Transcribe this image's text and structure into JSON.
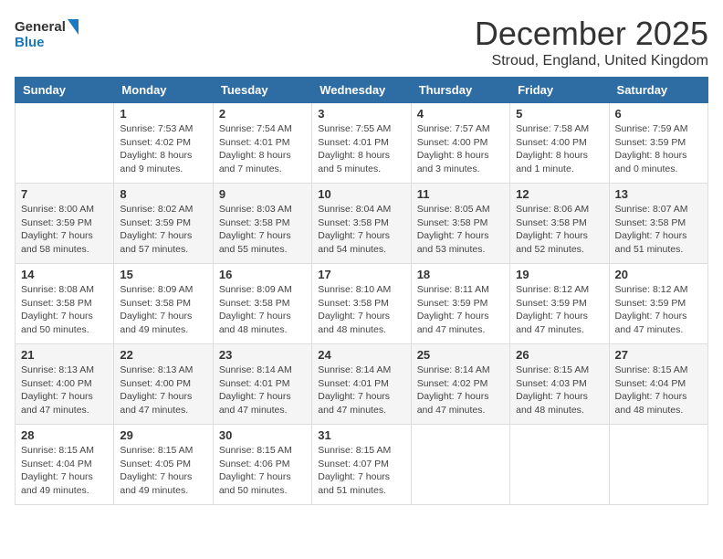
{
  "logo": {
    "line1": "General",
    "line2": "Blue"
  },
  "title": "December 2025",
  "location": "Stroud, England, United Kingdom",
  "weekdays": [
    "Sunday",
    "Monday",
    "Tuesday",
    "Wednesday",
    "Thursday",
    "Friday",
    "Saturday"
  ],
  "weeks": [
    [
      {
        "num": "",
        "sunrise": "",
        "sunset": "",
        "daylight": ""
      },
      {
        "num": "1",
        "sunrise": "7:53 AM",
        "sunset": "4:02 PM",
        "daylight": "8 hours and 9 minutes."
      },
      {
        "num": "2",
        "sunrise": "7:54 AM",
        "sunset": "4:01 PM",
        "daylight": "8 hours and 7 minutes."
      },
      {
        "num": "3",
        "sunrise": "7:55 AM",
        "sunset": "4:01 PM",
        "daylight": "8 hours and 5 minutes."
      },
      {
        "num": "4",
        "sunrise": "7:57 AM",
        "sunset": "4:00 PM",
        "daylight": "8 hours and 3 minutes."
      },
      {
        "num": "5",
        "sunrise": "7:58 AM",
        "sunset": "4:00 PM",
        "daylight": "8 hours and 1 minute."
      },
      {
        "num": "6",
        "sunrise": "7:59 AM",
        "sunset": "3:59 PM",
        "daylight": "8 hours and 0 minutes."
      }
    ],
    [
      {
        "num": "7",
        "sunrise": "8:00 AM",
        "sunset": "3:59 PM",
        "daylight": "7 hours and 58 minutes."
      },
      {
        "num": "8",
        "sunrise": "8:02 AM",
        "sunset": "3:59 PM",
        "daylight": "7 hours and 57 minutes."
      },
      {
        "num": "9",
        "sunrise": "8:03 AM",
        "sunset": "3:58 PM",
        "daylight": "7 hours and 55 minutes."
      },
      {
        "num": "10",
        "sunrise": "8:04 AM",
        "sunset": "3:58 PM",
        "daylight": "7 hours and 54 minutes."
      },
      {
        "num": "11",
        "sunrise": "8:05 AM",
        "sunset": "3:58 PM",
        "daylight": "7 hours and 53 minutes."
      },
      {
        "num": "12",
        "sunrise": "8:06 AM",
        "sunset": "3:58 PM",
        "daylight": "7 hours and 52 minutes."
      },
      {
        "num": "13",
        "sunrise": "8:07 AM",
        "sunset": "3:58 PM",
        "daylight": "7 hours and 51 minutes."
      }
    ],
    [
      {
        "num": "14",
        "sunrise": "8:08 AM",
        "sunset": "3:58 PM",
        "daylight": "7 hours and 50 minutes."
      },
      {
        "num": "15",
        "sunrise": "8:09 AM",
        "sunset": "3:58 PM",
        "daylight": "7 hours and 49 minutes."
      },
      {
        "num": "16",
        "sunrise": "8:09 AM",
        "sunset": "3:58 PM",
        "daylight": "7 hours and 48 minutes."
      },
      {
        "num": "17",
        "sunrise": "8:10 AM",
        "sunset": "3:58 PM",
        "daylight": "7 hours and 48 minutes."
      },
      {
        "num": "18",
        "sunrise": "8:11 AM",
        "sunset": "3:59 PM",
        "daylight": "7 hours and 47 minutes."
      },
      {
        "num": "19",
        "sunrise": "8:12 AM",
        "sunset": "3:59 PM",
        "daylight": "7 hours and 47 minutes."
      },
      {
        "num": "20",
        "sunrise": "8:12 AM",
        "sunset": "3:59 PM",
        "daylight": "7 hours and 47 minutes."
      }
    ],
    [
      {
        "num": "21",
        "sunrise": "8:13 AM",
        "sunset": "4:00 PM",
        "daylight": "7 hours and 47 minutes."
      },
      {
        "num": "22",
        "sunrise": "8:13 AM",
        "sunset": "4:00 PM",
        "daylight": "7 hours and 47 minutes."
      },
      {
        "num": "23",
        "sunrise": "8:14 AM",
        "sunset": "4:01 PM",
        "daylight": "7 hours and 47 minutes."
      },
      {
        "num": "24",
        "sunrise": "8:14 AM",
        "sunset": "4:01 PM",
        "daylight": "7 hours and 47 minutes."
      },
      {
        "num": "25",
        "sunrise": "8:14 AM",
        "sunset": "4:02 PM",
        "daylight": "7 hours and 47 minutes."
      },
      {
        "num": "26",
        "sunrise": "8:15 AM",
        "sunset": "4:03 PM",
        "daylight": "7 hours and 48 minutes."
      },
      {
        "num": "27",
        "sunrise": "8:15 AM",
        "sunset": "4:04 PM",
        "daylight": "7 hours and 48 minutes."
      }
    ],
    [
      {
        "num": "28",
        "sunrise": "8:15 AM",
        "sunset": "4:04 PM",
        "daylight": "7 hours and 49 minutes."
      },
      {
        "num": "29",
        "sunrise": "8:15 AM",
        "sunset": "4:05 PM",
        "daylight": "7 hours and 49 minutes."
      },
      {
        "num": "30",
        "sunrise": "8:15 AM",
        "sunset": "4:06 PM",
        "daylight": "7 hours and 50 minutes."
      },
      {
        "num": "31",
        "sunrise": "8:15 AM",
        "sunset": "4:07 PM",
        "daylight": "7 hours and 51 minutes."
      },
      {
        "num": "",
        "sunrise": "",
        "sunset": "",
        "daylight": ""
      },
      {
        "num": "",
        "sunrise": "",
        "sunset": "",
        "daylight": ""
      },
      {
        "num": "",
        "sunrise": "",
        "sunset": "",
        "daylight": ""
      }
    ]
  ]
}
